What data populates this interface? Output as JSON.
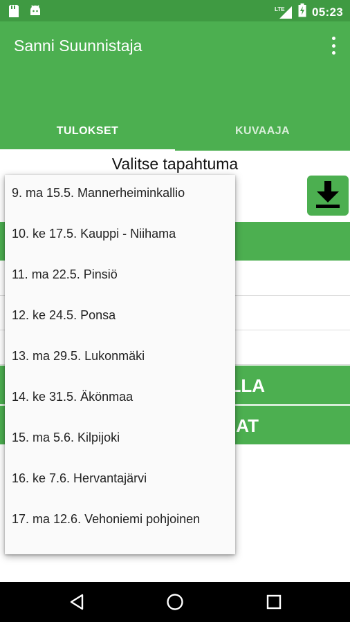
{
  "status_bar": {
    "time": "05:23",
    "network_label": "LTE",
    "icons": [
      "notification-icon",
      "android-icon",
      "signal-icon",
      "battery-charging-icon"
    ]
  },
  "app_bar": {
    "title": "Sanni Suunnistaja",
    "tabs": [
      {
        "label": "TULOKSET",
        "selected": true
      },
      {
        "label": "KUVAAJA",
        "selected": false
      }
    ]
  },
  "content": {
    "event_label": "Valitse tapahtuma",
    "green_rows": [
      "LLA",
      "AT"
    ]
  },
  "dropdown": {
    "items": [
      "9. ma 15.5. Mannerheiminkallio",
      "10. ke 17.5. Kauppi - Niihama",
      "11. ma 22.5. Pinsiö",
      "12. ke 24.5. Ponsa",
      "13. ma 29.5. Lukonmäki",
      "14. ke 31.5. Äkönmaa",
      "15. ma 5.6. Kilpijoki",
      "16. ke 7.6. Hervantajärvi",
      "17. ma 12.6. Vehoniemi pohjoinen"
    ]
  },
  "colors": {
    "primary": "#4caf50",
    "primary_dark": "#3f9a42",
    "dropdown_bg": "#fafafa"
  }
}
